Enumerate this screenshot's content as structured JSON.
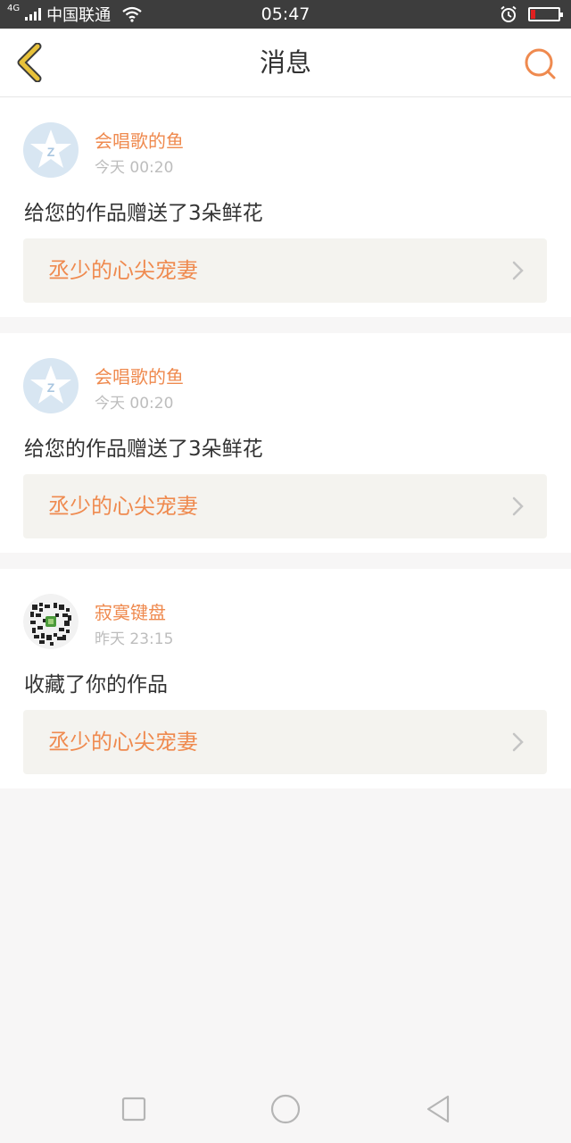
{
  "status_bar": {
    "network": "4G",
    "carrier": "中国联通",
    "time": "05:47"
  },
  "header": {
    "title": "消息"
  },
  "messages": [
    {
      "username": "会唱歌的鱼",
      "time": "今天 00:20",
      "text": "给您的作品赠送了3朵鲜花",
      "work_title": "丞少的心尖宠妻",
      "avatar_icon": "qzone-star-icon"
    },
    {
      "username": "会唱歌的鱼",
      "time": "今天 00:20",
      "text": "给您的作品赠送了3朵鲜花",
      "work_title": "丞少的心尖宠妻",
      "avatar_icon": "qzone-star-icon"
    },
    {
      "username": "寂寞键盘",
      "time": "昨天 23:15",
      "text": "收藏了你的作品",
      "work_title": "丞少的心尖宠妻",
      "avatar_icon": "qr-code-avatar"
    }
  ],
  "colors": {
    "accent": "#ef8a4f",
    "back_icon": "#e8c23a",
    "battery_level": "#e02020"
  },
  "battery_level": 0.15,
  "nav_icons": [
    "square-icon",
    "circle-icon",
    "triangle-back-icon"
  ]
}
